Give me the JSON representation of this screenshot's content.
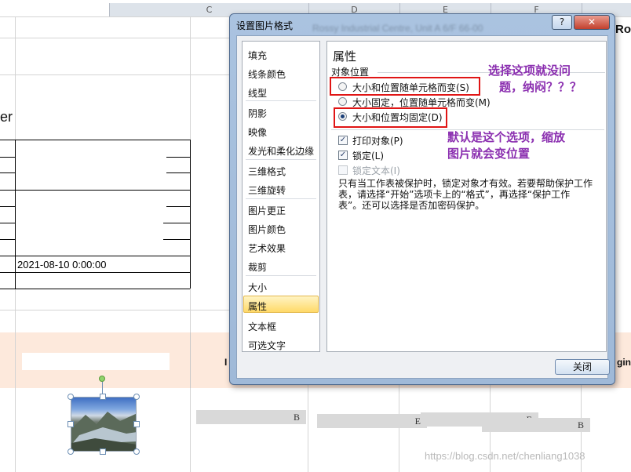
{
  "sheet": {
    "col_headers": [
      "C",
      "D",
      "E",
      "F"
    ],
    "partial_right_text": "Roa",
    "left_text": "er",
    "date_cell": "2021-08-10 0:00:00",
    "header_fragment_left": "I",
    "header_fragment_right": "ging",
    "gray_cell_labels": [
      "B",
      "E",
      "E",
      "B"
    ],
    "watermark": "https://blog.csdn.net/chenliang1038"
  },
  "dialog": {
    "title": "设置图片格式",
    "blurred_title": "Rossy Industrial Centre, Unit A 6/F 66-00",
    "help_label": "?",
    "close_x_label": "✕",
    "nav_items": [
      "填充",
      "线条颜色",
      "线型",
      "阴影",
      "映像",
      "发光和柔化边缘",
      "三维格式",
      "三维旋转",
      "图片更正",
      "图片颜色",
      "艺术效果",
      "裁剪",
      "大小",
      "属性",
      "文本框",
      "可选文字"
    ],
    "selected_item": "属性",
    "panel": {
      "heading": "属性",
      "group_label": "对象位置",
      "options": [
        "大小和位置随单元格而变(S)",
        "大小固定，位置随单元格而变(M)",
        "大小和位置均固定(D)"
      ],
      "selected_option": "大小和位置均固定(D)",
      "checkboxes": [
        {
          "label": "打印对象(P)",
          "checked": true,
          "disabled": false
        },
        {
          "label": "锁定(L)",
          "checked": true,
          "disabled": false
        },
        {
          "label": "锁定文本(I)",
          "checked": false,
          "disabled": true
        }
      ],
      "help_text": [
        "只有当工作表被保护时，锁定对象才有效。若要帮助保护工作",
        "表，请选择“开始”选项卡上的“格式”，再选择“保护工作",
        "表”。还可以选择是否加密码保护。"
      ]
    },
    "close_button": "关闭"
  },
  "annotations": {
    "note1": [
      "选择这项就没问",
      "题，纳闷？？？"
    ],
    "note2": [
      "默认是这个选项，缩放",
      "图片就会变位置"
    ]
  },
  "colors": {
    "annotation_text": "#8b2fb0",
    "highlight_border": "#e01515",
    "header_band": "#fde9dc"
  }
}
